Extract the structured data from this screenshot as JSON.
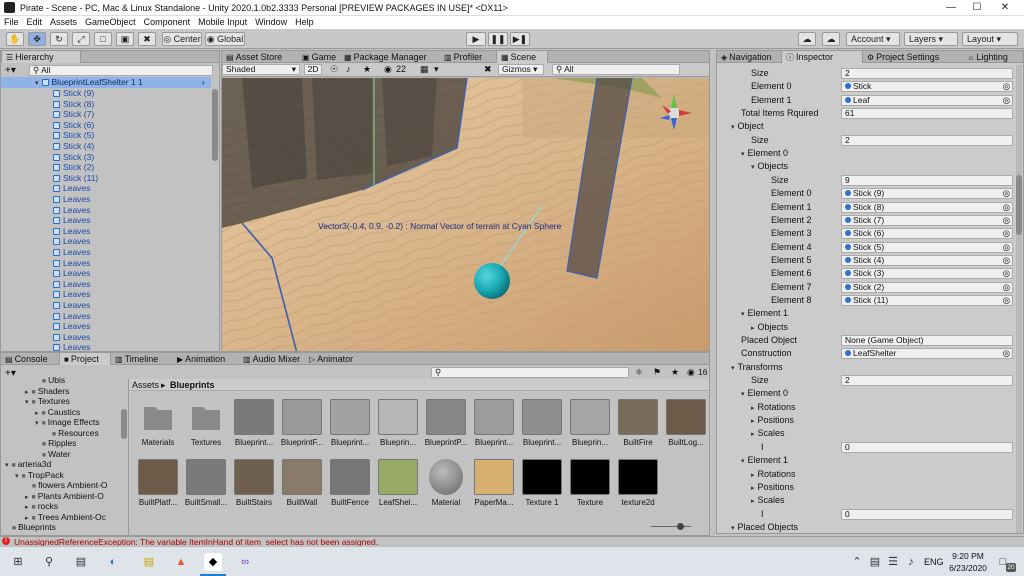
{
  "window": {
    "title": "Pirate - Scene - PC, Mac & Linux Standalone - Unity 2020.1.0b2.3333 Personal [PREVIEW PACKAGES IN USE]* <DX11>"
  },
  "menu": [
    "File",
    "Edit",
    "Assets",
    "GameObject",
    "Component",
    "Mobile Input",
    "Window",
    "Help"
  ],
  "toolbar": {
    "center": "Center",
    "global": "Global",
    "account": "Account",
    "layers": "Layers",
    "layout": "Layout"
  },
  "hierarchy": {
    "tab": "Hierarchy",
    "search_placeholder": "All",
    "root": "BlueprintLeafShelter 1 1",
    "items": [
      "Stick (9)",
      "Stick (8)",
      "Stick (7)",
      "Stick (6)",
      "Stick (5)",
      "Stick (4)",
      "Stick (3)",
      "Stick (2)",
      "Stick (11)",
      "Leaves",
      "Leaves",
      "Leaves",
      "Leaves",
      "Leaves",
      "Leaves",
      "Leaves",
      "Leaves",
      "Leaves",
      "Leaves",
      "Leaves",
      "Leaves",
      "Leaves",
      "Leaves",
      "Leaves",
      "Leaves"
    ]
  },
  "scene_tabs": [
    "Asset Store",
    "Game",
    "Package Manager",
    "Profiler",
    "Scene"
  ],
  "scene_toolbar": {
    "shading": "Shaded",
    "mode2d": "2D",
    "layers_count": "22",
    "gizmos": "Gizmos",
    "search": "All"
  },
  "scene": {
    "annotation": "Vector3(-0.4, 0.9, -0.2) : Normal Vector of terrain at Cyan Sphere",
    "sphere_color": "#17a9b3",
    "sand_color": "#d9b58a"
  },
  "inspector_tabs": [
    "Navigation",
    "Inspector",
    "Project Settings",
    "Lighting"
  ],
  "inspector": {
    "rows": [
      {
        "indent": 2,
        "label": "Size",
        "value": "2",
        "kind": "text"
      },
      {
        "indent": 2,
        "label": "Element 0",
        "value": "Stick",
        "kind": "ref"
      },
      {
        "indent": 2,
        "label": "Element 1",
        "value": "Leaf",
        "kind": "ref"
      },
      {
        "indent": 1,
        "label": "Total Items Rquired",
        "value": "61",
        "kind": "text"
      },
      {
        "indent": 1,
        "label": "Object",
        "value": "",
        "kind": "fold"
      },
      {
        "indent": 2,
        "label": "Size",
        "value": "2",
        "kind": "text"
      },
      {
        "indent": 2,
        "label": "Element 0",
        "value": "",
        "kind": "fold"
      },
      {
        "indent": 3,
        "label": "Objects",
        "value": "",
        "kind": "fold"
      },
      {
        "indent": 4,
        "label": "Size",
        "value": "9",
        "kind": "text"
      },
      {
        "indent": 4,
        "label": "Element 0",
        "value": "Stick (9)",
        "kind": "ref"
      },
      {
        "indent": 4,
        "label": "Element 1",
        "value": "Stick (8)",
        "kind": "ref"
      },
      {
        "indent": 4,
        "label": "Element 2",
        "value": "Stick (7)",
        "kind": "ref"
      },
      {
        "indent": 4,
        "label": "Element 3",
        "value": "Stick (6)",
        "kind": "ref"
      },
      {
        "indent": 4,
        "label": "Element 4",
        "value": "Stick (5)",
        "kind": "ref"
      },
      {
        "indent": 4,
        "label": "Element 5",
        "value": "Stick (4)",
        "kind": "ref"
      },
      {
        "indent": 4,
        "label": "Element 6",
        "value": "Stick (3)",
        "kind": "ref"
      },
      {
        "indent": 4,
        "label": "Element 7",
        "value": "Stick (2)",
        "kind": "ref"
      },
      {
        "indent": 4,
        "label": "Element 8",
        "value": "Stick (11)",
        "kind": "ref"
      },
      {
        "indent": 2,
        "label": "Element 1",
        "value": "",
        "kind": "fold"
      },
      {
        "indent": 3,
        "label": "Objects",
        "value": "",
        "kind": "foldc"
      },
      {
        "indent": 1,
        "label": "Placed Object",
        "value": "None (Game Object)",
        "kind": "text"
      },
      {
        "indent": 1,
        "label": "Construction",
        "value": "LeafShelter",
        "kind": "ref"
      },
      {
        "indent": 1,
        "label": "Transforms",
        "value": "",
        "kind": "fold"
      },
      {
        "indent": 2,
        "label": "Size",
        "value": "2",
        "kind": "text"
      },
      {
        "indent": 2,
        "label": "Element 0",
        "value": "",
        "kind": "fold"
      },
      {
        "indent": 3,
        "label": "Rotations",
        "value": "",
        "kind": "foldc"
      },
      {
        "indent": 3,
        "label": "Positions",
        "value": "",
        "kind": "foldc"
      },
      {
        "indent": 3,
        "label": "Scales",
        "value": "",
        "kind": "foldc"
      },
      {
        "indent": 3,
        "label": "I",
        "value": "0",
        "kind": "text"
      },
      {
        "indent": 2,
        "label": "Element 1",
        "value": "",
        "kind": "fold"
      },
      {
        "indent": 3,
        "label": "Rotations",
        "value": "",
        "kind": "foldc"
      },
      {
        "indent": 3,
        "label": "Positions",
        "value": "",
        "kind": "foldc"
      },
      {
        "indent": 3,
        "label": "Scales",
        "value": "",
        "kind": "foldc"
      },
      {
        "indent": 3,
        "label": "I",
        "value": "0",
        "kind": "text"
      },
      {
        "indent": 1,
        "label": "Placed Objects",
        "value": "",
        "kind": "fold"
      }
    ]
  },
  "bottom_tabs": [
    "Console",
    "Project",
    "Timeline",
    "Animation",
    "Audio Mixer",
    "Animator"
  ],
  "project_tree": [
    {
      "indent": 3,
      "label": "Ubis",
      "fold": ""
    },
    {
      "indent": 2,
      "label": "Shaders",
      "fold": "▸"
    },
    {
      "indent": 2,
      "label": "Textures",
      "fold": "▾"
    },
    {
      "indent": 3,
      "label": "Caustics",
      "fold": "▸"
    },
    {
      "indent": 3,
      "label": "Image Effects",
      "fold": "▾"
    },
    {
      "indent": 4,
      "label": "Resources",
      "fold": ""
    },
    {
      "indent": 3,
      "label": "Ripples",
      "fold": ""
    },
    {
      "indent": 3,
      "label": "Water",
      "fold": ""
    },
    {
      "indent": 0,
      "label": "arteria3d",
      "fold": "▾"
    },
    {
      "indent": 1,
      "label": "TropPack",
      "fold": "▾"
    },
    {
      "indent": 2,
      "label": "flowers Ambient-O",
      "fold": ""
    },
    {
      "indent": 2,
      "label": "Plants Ambient-O",
      "fold": "▸"
    },
    {
      "indent": 2,
      "label": "rocks",
      "fold": "▸"
    },
    {
      "indent": 2,
      "label": "Trees Ambient-Oc",
      "fold": "▸"
    },
    {
      "indent": 0,
      "label": "Blueprints",
      "fold": ""
    }
  ],
  "project": {
    "breadcrumb_root": "Assets",
    "breadcrumb_sep": "▸",
    "breadcrumb_leaf": "Blueprints",
    "count": "16",
    "assets_row1": [
      "Materials",
      "Textures",
      "Blueprint...",
      "BlueprintF...",
      "Blueprint...",
      "Blueprin...",
      "BlueprintP...",
      "Blueprint...",
      "Blueprint...",
      "Blueprin...",
      "BuiltFire",
      "BuiltLog..."
    ],
    "assets_row2": [
      "BuiltPlatf...",
      "BuiltSmall...",
      "BuiltStairs",
      "BuiltWall",
      "BuiltFence",
      "LeafShel...",
      "Material",
      "PaperMa...",
      "Texture 1",
      "Texture",
      "texture2d"
    ]
  },
  "status": {
    "message": "UnassignedReferenceException: The variable ItemInHand of item_select has not been assigned."
  },
  "taskbar": {
    "lang": "ENG",
    "time": "9:20 PM",
    "date": "6/23/2020",
    "notif": "20"
  }
}
